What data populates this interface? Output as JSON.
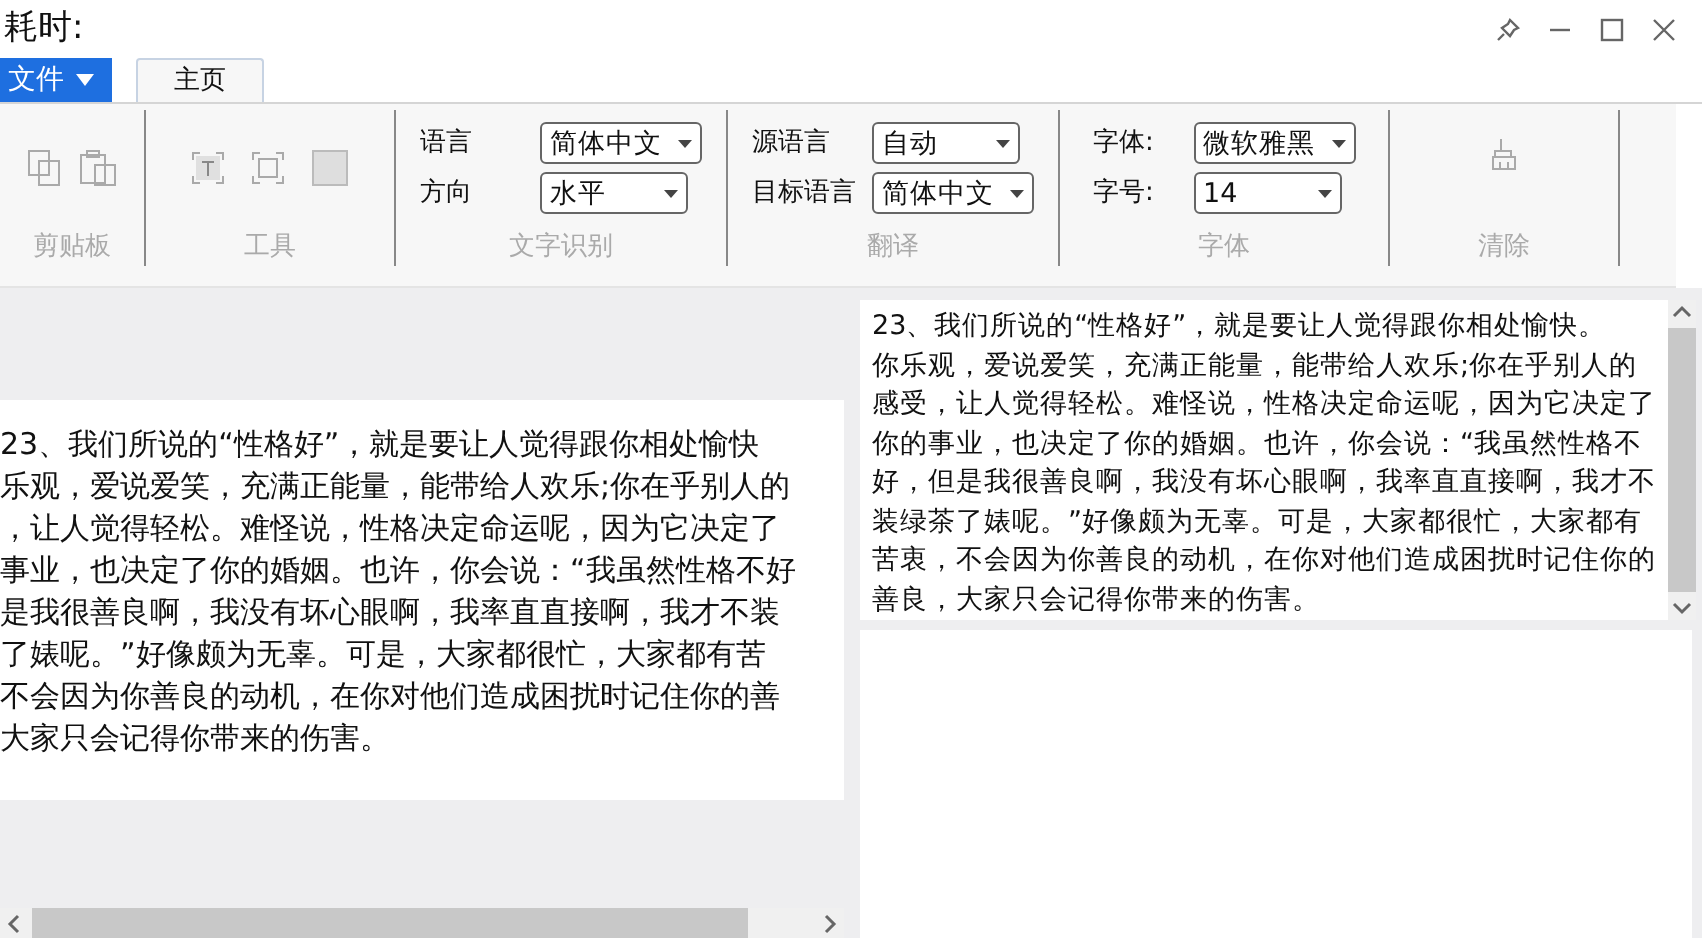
{
  "window": {
    "title": "耗时:"
  },
  "file_menu": {
    "label": "文件"
  },
  "tabs": [
    {
      "label": "主页",
      "selected": true
    }
  ],
  "ribbon": {
    "groups": [
      {
        "kind": "clipboard",
        "label": "剪贴板"
      },
      {
        "kind": "tools",
        "label": "工具"
      },
      {
        "kind": "fields",
        "label": "文字识别",
        "fields": [
          {
            "label": "语言",
            "value": "简体中文"
          },
          {
            "label": "方向",
            "value": "水平"
          }
        ]
      },
      {
        "kind": "fields",
        "label": "翻译",
        "fields": [
          {
            "label": "源语言",
            "value": "自动"
          },
          {
            "label": "目标语言",
            "value": "简体中文"
          }
        ]
      },
      {
        "kind": "fields",
        "label": "字体",
        "fields": [
          {
            "label": "字体:",
            "value": "微软雅黑"
          },
          {
            "label": "字号:",
            "value": "14"
          }
        ]
      },
      {
        "kind": "clear",
        "label": "清除"
      }
    ]
  },
  "source_text": {
    "lines": [
      "23、我们所说的“性格好”，就是要让人觉得跟你相处愉快",
      "乐观，爱说爱笑，充满正能量，能带给人欢乐;你在乎别人的",
      "，让人觉得轻松。难怪说，性格决定命运呢，因为它决定了",
      "事业，也决定了你的婚姻。也许，你会说：“我虽然性格不好",
      "是我很善良啊，我没有坏心眼啊，我率直直接啊，我才不装",
      "了婊呢。”好像颇为无辜。可是，大家都很忙，大家都有苦",
      "不会因为你善良的动机，在你对他们造成困扰时记住你的善",
      "大家只会记得你带来的伤害。"
    ]
  },
  "result_text": {
    "lines": [
      "23、我们所说的“性格好”，就是要让人觉得跟你相处愉快。",
      "你乐观，爱说爱笑，充满正能量，能带给人欢乐;你在乎别人的",
      "感受，让人觉得轻松。难怪说，性格决定命运呢，因为它决定了",
      "你的事业，也决定了你的婚姻。也许，你会说：“我虽然性格不",
      "好，但是我很善良啊，我没有坏心眼啊，我率直直接啊，我才不",
      "装绿茶了婊呢。”好像颇为无辜。可是，大家都很忙，大家都有",
      "苦衷，不会因为你善良的动机，在你对他们造成困扰时记住你的",
      "善良，大家只会记得你带来的伤害。"
    ]
  }
}
